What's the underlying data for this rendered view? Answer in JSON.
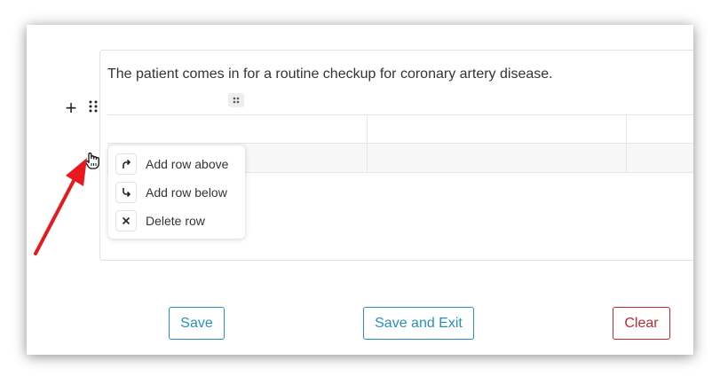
{
  "editor": {
    "paragraph": "The patient comes in for a routine checkup for coronary artery disease."
  },
  "row_menu": {
    "items": [
      {
        "label": "Add row above",
        "icon": "arrow-up-right-icon"
      },
      {
        "label": "Add row below",
        "icon": "arrow-down-right-icon"
      },
      {
        "label": "Delete row",
        "icon": "close-icon"
      }
    ]
  },
  "actions": {
    "save_label": "Save",
    "save_exit_label": "Save and Exit",
    "clear_label": "Clear"
  },
  "colors": {
    "primary": "#2a8fc0",
    "danger": "#c0282f",
    "annotation_arrow": "#e8191d"
  }
}
